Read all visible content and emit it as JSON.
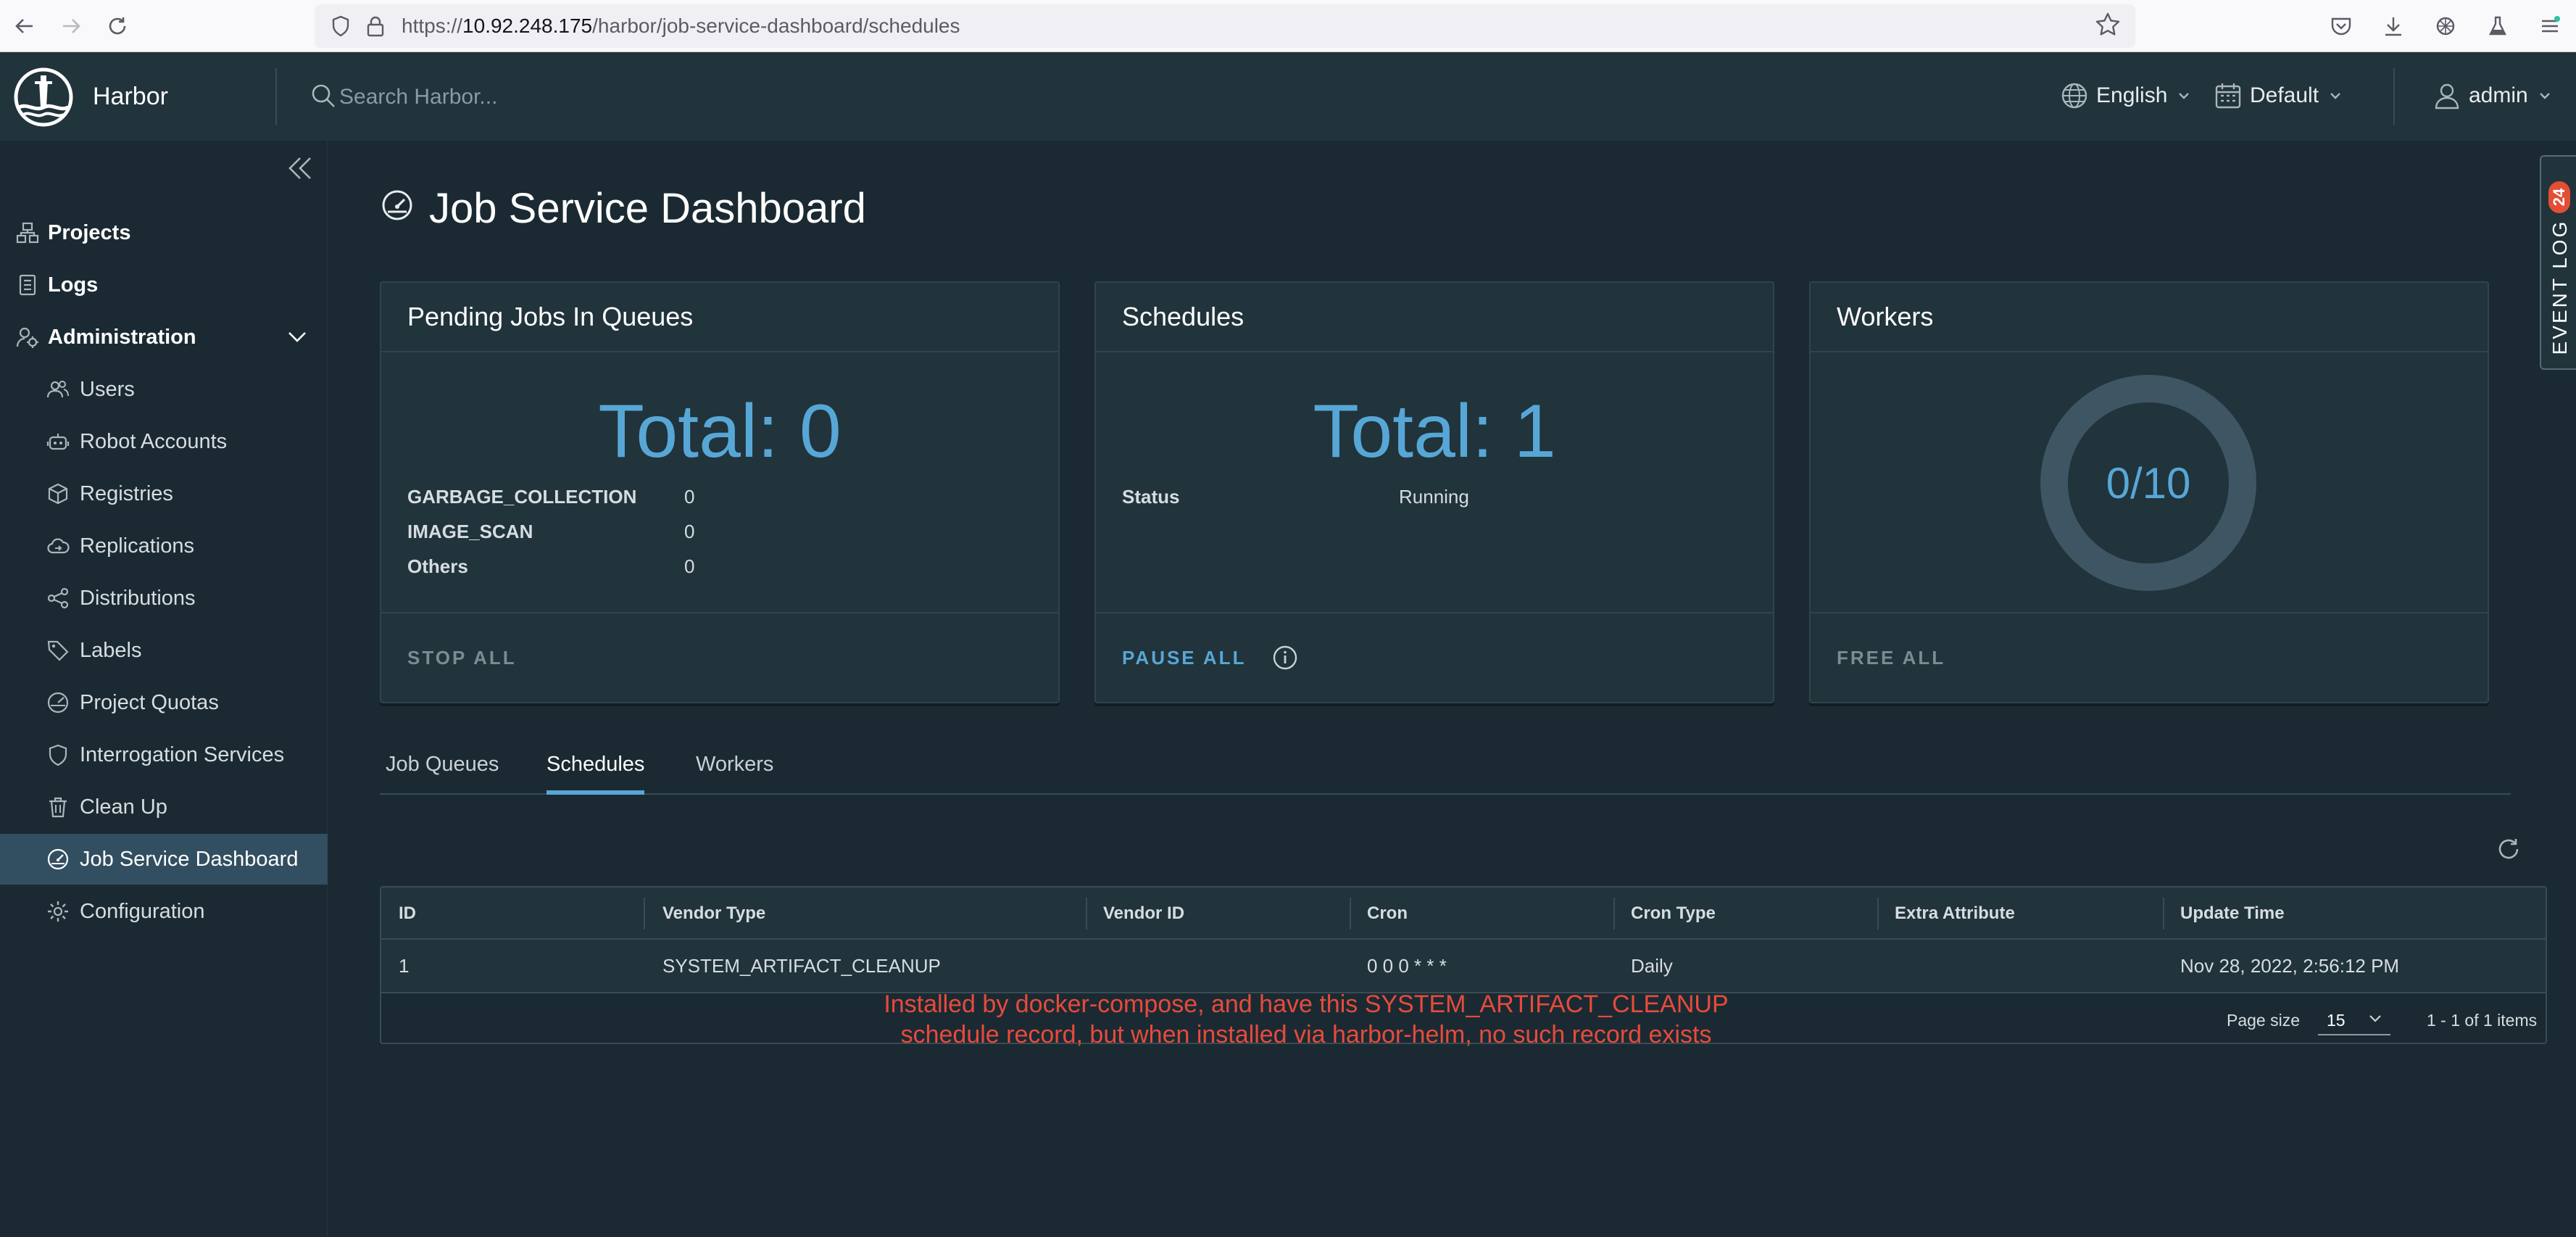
{
  "browser": {
    "url_prefix": "https://",
    "url_host": "10.92.248.175",
    "url_path": "/harbor/job-service-dashboard/schedules"
  },
  "header": {
    "brand": "Harbor",
    "search_placeholder": "Search Harbor...",
    "language": "English",
    "theme": "Default",
    "user": "admin"
  },
  "sidebar": {
    "items": [
      {
        "label": "Projects"
      },
      {
        "label": "Logs"
      },
      {
        "label": "Administration"
      },
      {
        "label": "Users"
      },
      {
        "label": "Robot Accounts"
      },
      {
        "label": "Registries"
      },
      {
        "label": "Replications"
      },
      {
        "label": "Distributions"
      },
      {
        "label": "Labels"
      },
      {
        "label": "Project Quotas"
      },
      {
        "label": "Interrogation Services"
      },
      {
        "label": "Clean Up"
      },
      {
        "label": "Job Service Dashboard"
      },
      {
        "label": "Configuration"
      }
    ]
  },
  "page": {
    "title": "Job Service Dashboard"
  },
  "cards": {
    "pending": {
      "title": "Pending Jobs In Queues",
      "total": "Total: 0",
      "rows": [
        {
          "k": "GARBAGE_COLLECTION",
          "v": "0"
        },
        {
          "k": "IMAGE_SCAN",
          "v": "0"
        },
        {
          "k": "Others",
          "v": "0"
        }
      ],
      "action": "STOP ALL"
    },
    "schedules": {
      "title": "Schedules",
      "total": "Total: 1",
      "status_key": "Status",
      "status_value": "Running",
      "action": "PAUSE ALL"
    },
    "workers": {
      "title": "Workers",
      "usage": "0/10",
      "used": 0,
      "total": 10,
      "action": "FREE ALL"
    }
  },
  "tabs": [
    {
      "label": "Job Queues"
    },
    {
      "label": "Schedules"
    },
    {
      "label": "Workers"
    }
  ],
  "table": {
    "columns": [
      "ID",
      "Vendor Type",
      "Vendor ID",
      "Cron",
      "Cron Type",
      "Extra Attribute",
      "Update Time"
    ],
    "rows": [
      [
        "1",
        "SYSTEM_ARTIFACT_CLEANUP",
        "",
        "0 0 0 * * *",
        "Daily",
        "",
        "Nov 28, 2022, 2:56:12 PM"
      ]
    ],
    "page_size_label": "Page size",
    "page_size": "15",
    "count": "1 - 1 of 1 items"
  },
  "annotation": {
    "line1": "Installed by docker-compose, and have this SYSTEM_ARTIFACT_CLEANUP",
    "line2": "schedule record, but when installed via harbor-helm, no such record exists"
  },
  "event_log": {
    "label": "EVENT LOG",
    "count": "24"
  },
  "colors": {
    "accent": "#57a7d6",
    "header_bg": "#21333b",
    "page_bg": "#1b2a32",
    "annotation": "#e84a3c",
    "badge": "#e44e35"
  }
}
